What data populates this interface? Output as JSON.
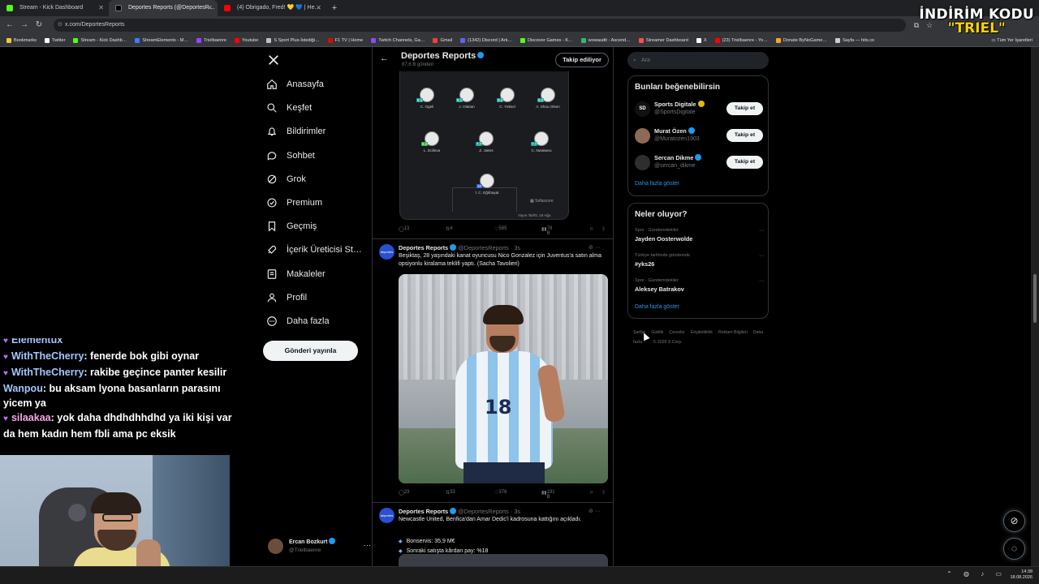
{
  "browser": {
    "tabs": [
      {
        "title": "Stream - Kick Dashboard",
        "favicon_color": "#53fc18",
        "active": false
      },
      {
        "title": "Deportes Reports (@DeportesR…",
        "favicon_color": "#000000",
        "active": true
      },
      {
        "title": "(4) Obrigado, Fred! 💛 💙 | He…",
        "favicon_color": "#ff0000",
        "active": false
      }
    ],
    "new_tab_label": "+",
    "url": "x.com/DeportesReports",
    "bookmarks": [
      {
        "label": "Bookmarks",
        "color": "#f5c542"
      },
      {
        "label": "Twitter",
        "color": "#ffffff"
      },
      {
        "label": "Stream - Kick Dashb…",
        "color": "#53fc18"
      },
      {
        "label": "StreamElements - M…",
        "color": "#3d7cff"
      },
      {
        "label": "Trielbaenre",
        "color": "#9146ff"
      },
      {
        "label": "Youtube",
        "color": "#ff0000"
      },
      {
        "label": "S Sport Plus-İstediği…",
        "color": "#c0c0c0"
      },
      {
        "label": "F1 TV | Home",
        "color": "#e10600"
      },
      {
        "label": "Twitch Channels, Ga…",
        "color": "#9146ff"
      },
      {
        "label": "Gmail",
        "color": "#ea4335"
      },
      {
        "label": "(1342) Discord | Ark…",
        "color": "#5865f2"
      },
      {
        "label": "Discover Games - K…",
        "color": "#53fc18"
      },
      {
        "label": "wowaudit - Ascend…",
        "color": "#3cb371"
      },
      {
        "label": "Streamer Dashboard",
        "color": "#ff4d4d"
      },
      {
        "label": "X",
        "color": "#ffffff"
      },
      {
        "label": "(23) Trielbaenre - Yo…",
        "color": "#ff0000"
      },
      {
        "label": "Donate ByNoGame…",
        "color": "#f5a623"
      },
      {
        "label": "Sayfa — hits.co",
        "color": "#cccccc"
      }
    ],
    "all_bookmarks_label": "Tüm Yer İşaretleri"
  },
  "promo": {
    "line1": "İNDİRİM KODU",
    "line2": "\"TRIEL\""
  },
  "chat": [
    {
      "user": "Elementux",
      "text": "",
      "color": "#a3c6ff",
      "heart": true
    },
    {
      "user": "WithTheCherry",
      "text": ": fenerde bok gibi oynar",
      "color": "#a3c6ff",
      "heart": true
    },
    {
      "user": "WithTheCherry",
      "text": ": rakibe geçince panter kesilir",
      "color": "#a3c6ff",
      "heart": true
    },
    {
      "user": "Wanpou",
      "text": ": bu aksam lyona basanların parasını",
      "color": "#a3c6ff",
      "heart": false
    },
    {
      "user": "",
      "text": "yicem ya",
      "color": "#a3c6ff",
      "heart": false
    },
    {
      "user": "silaakaa",
      "text": ": yok daha dhdhdhhdhd ya iki kişi var",
      "color": "#f7a6e4",
      "heart": true
    },
    {
      "user": "",
      "text": "da hem kadın hem fbli ama pc eksik",
      "color": "#f7a6e4",
      "heart": false
    }
  ],
  "nav": {
    "items": [
      {
        "label": "Anasayfa",
        "icon": "home-icon"
      },
      {
        "label": "Keşfet",
        "icon": "search-icon"
      },
      {
        "label": "Bildirimler",
        "icon": "bell-icon"
      },
      {
        "label": "Sohbet",
        "icon": "chat-icon"
      },
      {
        "label": "Grok",
        "icon": "grok-icon"
      },
      {
        "label": "Premium",
        "icon": "premium-icon"
      },
      {
        "label": "Geçmiş",
        "icon": "bookmark-icon"
      },
      {
        "label": "İçerik Üreticisi St…",
        "icon": "rocket-icon"
      },
      {
        "label": "Makaleler",
        "icon": "article-icon"
      },
      {
        "label": "Profil",
        "icon": "profile-icon"
      },
      {
        "label": "Daha fazla",
        "icon": "more-circle-icon"
      }
    ],
    "post_button": "Gönderi yayınla",
    "account": {
      "name": "Ercan Bozkurt",
      "handle": "@Trielbaenre",
      "more": "···"
    }
  },
  "profile_header": {
    "name": "Deportes Reports",
    "posts": "87,6 B gönderi",
    "follow_label": "Takip ediliyor",
    "back": "←"
  },
  "lineup": {
    "players": [
      {
        "name": "C. Ogeli",
        "rating": "8.1"
      },
      {
        "name": "J. Olaitan",
        "rating": "8.1"
      },
      {
        "name": "C. Yüksel",
        "rating": "8.2"
      },
      {
        "name": "A. Shou Olsen",
        "rating": "8.2"
      },
      {
        "name": "L. Dollova",
        "rating": "8.2"
      },
      {
        "name": "Z. Jakes",
        "rating": "7.7"
      },
      {
        "name": "C. Nwakaeu",
        "rating": "7.7"
      },
      {
        "name": "İ. C. Eğribayat",
        "rating": "10"
      }
    ],
    "source": "Sofascore",
    "date": "Yayın Tarihi: 18 Ağu"
  },
  "tweet1_stats": {
    "replies": "13",
    "reposts": "4",
    "likes": "585",
    "views": "78 B"
  },
  "tweet2": {
    "author": "Deportes Reports",
    "handle": "@DeportesReports · 3s",
    "text": "Beşiktaş, 28 yaşındaki kanat oyuncusu Nico Gonzalez için Juventus'a satın alma opsiyonlu kiralama teklifi yaptı. (Sacha Tavolieri)",
    "photo_number": "18",
    "stats": {
      "replies": "23",
      "reposts": "33",
      "likes": "376",
      "views": "191 B"
    }
  },
  "tweet3": {
    "author": "Deportes Reports",
    "handle": "@DeportesReports · 3s",
    "text": "Newcastle United, Benfica'dan Amar Dedic'i kadrosuna kattığını açıkladı.",
    "bullets": [
      "Bonservis: 35,9 M€",
      "Sonraki satışta kârdan pay: %18"
    ]
  },
  "avatar_text": "deportes",
  "right": {
    "search_placeholder": "Ara",
    "suggest_title": "Bunları beğenebilirsin",
    "suggestions": [
      {
        "name": "Sports Digitale",
        "handle": "@SportsDigitale",
        "follow": "Takip et",
        "gold": true
      },
      {
        "name": "Murat Özen",
        "handle": "@Muratozen1903",
        "follow": "Takip et",
        "gold": false
      },
      {
        "name": "Sercan Dikme",
        "handle": "@sercan_dikme",
        "follow": "Takip et",
        "gold": false
      }
    ],
    "show_more": "Daha fazla göster",
    "trends_title": "Neler oluyor?",
    "trends": [
      {
        "context": "Spor · Gündemdekiler",
        "title": "Jayden Oosterwolde"
      },
      {
        "context": "Türkiye tarihinde gündemde",
        "title": "#yks26"
      },
      {
        "context": "Spor · Gündemdekiler",
        "title": "Aleksey Batrakov"
      }
    ],
    "show_more2": "Daha fazla göster",
    "footer": [
      "Şartlar",
      "Gizlilik",
      "Çerezler",
      "Erişilebilirlik",
      "Reklam Bilgileri",
      "Daha fazla ···",
      "© 2026 X Corp."
    ]
  },
  "taskbar": {
    "time": "14:38",
    "date": "18.08.2026"
  }
}
